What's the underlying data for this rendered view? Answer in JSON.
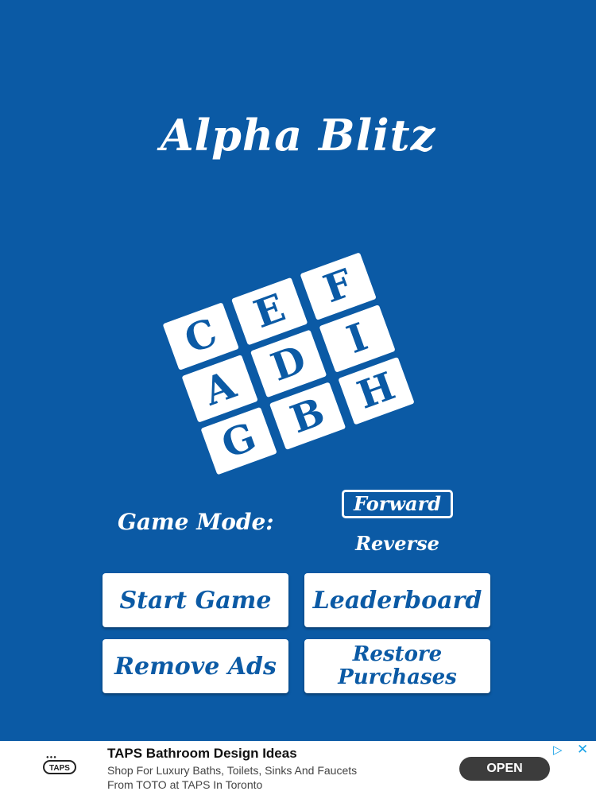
{
  "app": {
    "title": "Alpha Blitz"
  },
  "logo": {
    "tiles": [
      "C",
      "E",
      "F",
      "A",
      "D",
      "I",
      "G",
      "B",
      "H"
    ]
  },
  "game_mode": {
    "label": "Game Mode:",
    "options": [
      "Forward",
      "Reverse"
    ],
    "selected": "Forward"
  },
  "buttons": {
    "start": "Start Game",
    "leaderboard": "Leaderboard",
    "remove_ads": "Remove Ads",
    "restore_line1": "Restore",
    "restore_line2": "Purchases"
  },
  "ad": {
    "logo_text": "TAPS",
    "title": "TAPS Bathroom Design Ideas",
    "line1": "Shop For Luxury Baths, Toilets, Sinks And Faucets",
    "line2": "From TOTO at TAPS In Toronto",
    "cta": "OPEN",
    "choices_icon": "adchoices-icon",
    "close_icon": "close-icon"
  },
  "colors": {
    "background": "#0b5aa5",
    "tile": "#ffffff",
    "tile_text": "#0b5aa5"
  }
}
